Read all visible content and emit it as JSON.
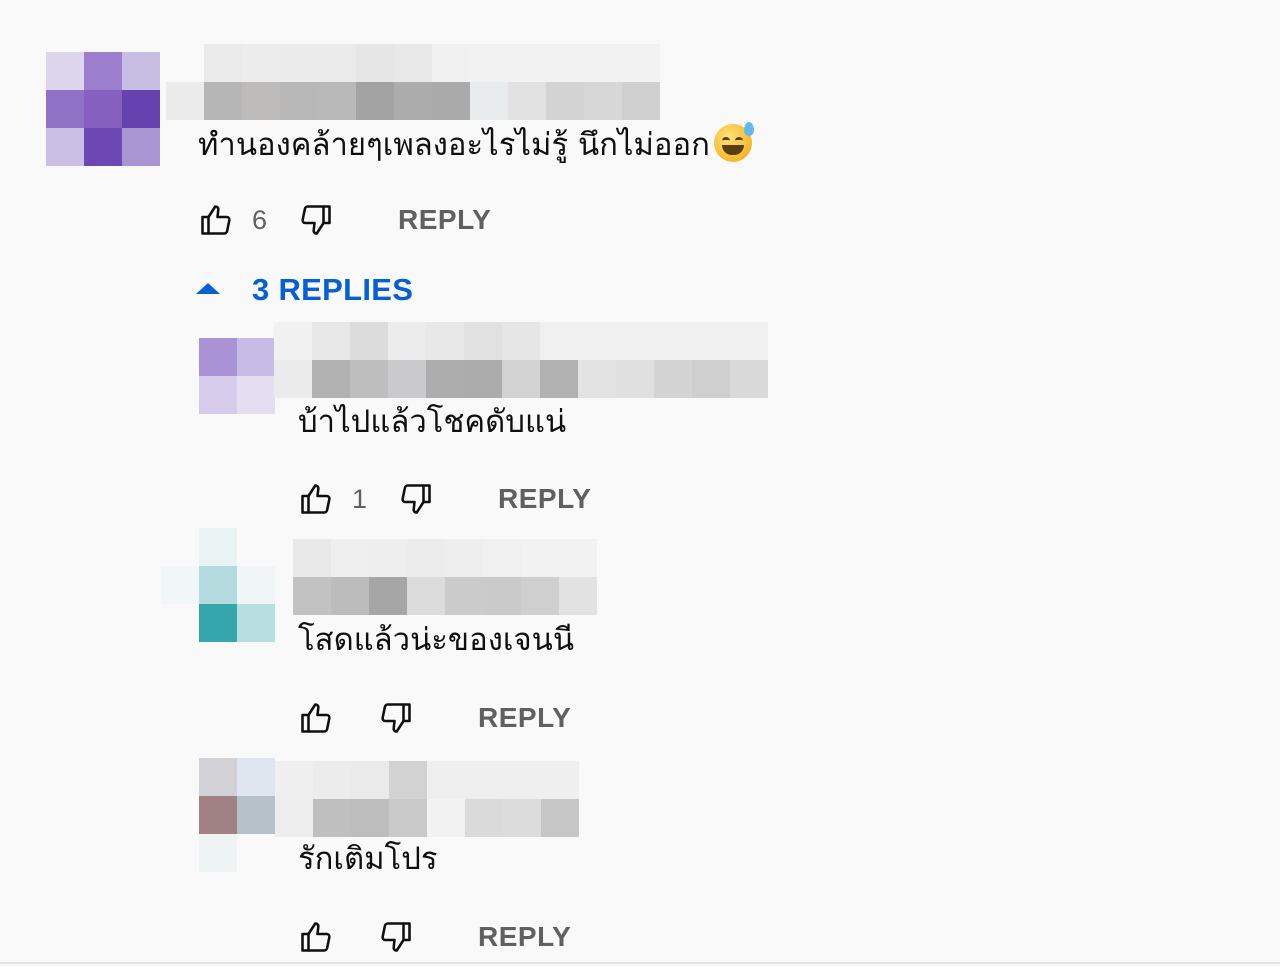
{
  "comment": {
    "text": "ทำนองคล้ายๆเพลงอะไรไม่รู้ นึกไม่ออก",
    "emoji": "grinning-face-with-sweat",
    "likes": "6",
    "reply_label": "REPLY"
  },
  "replies_toggle": {
    "label": "3 REPLIES",
    "icon": "caret-up-icon",
    "color": "#065fd4"
  },
  "replies": [
    {
      "text": "บ้าไปแล้วโชคดับแน่",
      "likes": "1",
      "reply_label": "REPLY"
    },
    {
      "text": "โสดแล้วน่ะของเจนนี",
      "likes": "",
      "reply_label": "REPLY"
    },
    {
      "text": "รักเติมโปร",
      "likes": "",
      "reply_label": "REPLY"
    }
  ],
  "icons": {
    "like": "thumb-up-icon",
    "dislike": "thumb-down-icon"
  },
  "colors": {
    "background": "#f9f9f9",
    "secondary_text": "#606060",
    "accent": "#065fd4"
  }
}
